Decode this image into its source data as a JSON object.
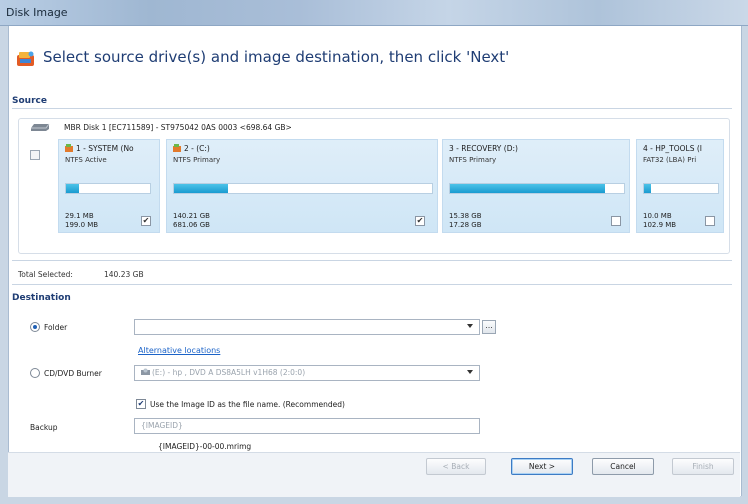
{
  "window": {
    "title": "Disk Image"
  },
  "heading": "Select source drive(s) and image destination, then click 'Next'",
  "source": {
    "label": "Source",
    "disk_label": "MBR Disk 1 [EC711589] - ST975042 0AS          0003  <698.64 GB>",
    "partitions": [
      {
        "name": "1 - SYSTEM (No",
        "type": "NTFS Active",
        "used": "29.1 MB",
        "total": "199.0 MB",
        "checked": true,
        "used_fraction": 0.15
      },
      {
        "name": "2 - (C:)",
        "type": "NTFS Primary",
        "used": "140.21 GB",
        "total": "681.06 GB",
        "checked": true,
        "used_fraction": 0.21
      },
      {
        "name": "3 - RECOVERY (D:)",
        "type": "NTFS Primary",
        "used": "15.38 GB",
        "total": "17.28 GB",
        "checked": false,
        "used_fraction": 0.89
      },
      {
        "name": "4 - HP_TOOLS (I",
        "type": "FAT32 (LBA) Pri",
        "used": "10.0 MB",
        "total": "102.9 MB",
        "checked": false,
        "used_fraction": 0.1
      }
    ],
    "total_label": "Total Selected:",
    "total_value": "140.23 GB"
  },
  "destination": {
    "label": "Destination",
    "folder_label": "Folder",
    "folder_value": "",
    "browse_label": "...",
    "alt_link": "Alternative locations",
    "cd_label": "CD/DVD Burner",
    "cd_value": "(E:) - hp     , DVD A  DS8A5LH   v1H68 (2:0:0)",
    "use_id_label": "Use the Image ID as the file name.  (Recommended)",
    "use_id_checked": true,
    "backup_label": "Backup",
    "backup_value": "{IMAGEID}",
    "filename_preview": "{IMAGEID}-00-00.mrimg"
  },
  "buttons": {
    "back": "< Back",
    "next": "Next >",
    "cancel": "Cancel",
    "finish": "Finish"
  },
  "colors": {
    "accent": "#1f3d74",
    "bar_fill": "#1a9bd0",
    "link": "#1b63c8"
  }
}
